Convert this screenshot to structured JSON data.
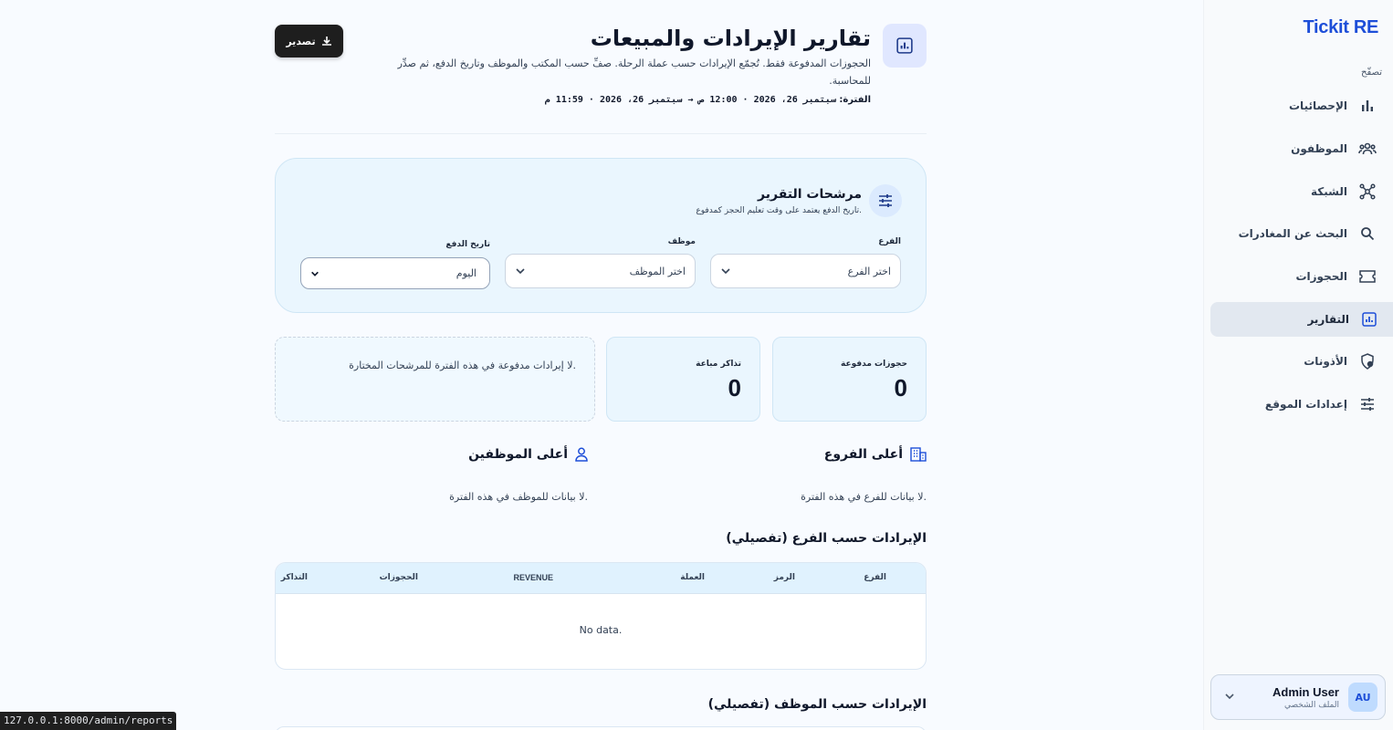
{
  "sidebar": {
    "brand": "Tickit RE",
    "nav_heading": "تصفّح",
    "items": [
      {
        "label": "الإحصائيات",
        "icon": "bar-chart-icon"
      },
      {
        "label": "الموظفون",
        "icon": "users-icon"
      },
      {
        "label": "الشبكة",
        "icon": "network-icon"
      },
      {
        "label": "البحث عن المغادرات",
        "icon": "search-icon"
      },
      {
        "label": "الحجوزات",
        "icon": "ticket-icon"
      },
      {
        "label": "التقارير",
        "icon": "report-icon",
        "active": true
      },
      {
        "label": "الأذونات",
        "icon": "shield-icon"
      },
      {
        "label": "إعدادات الموقع",
        "icon": "sliders-icon"
      }
    ],
    "user": {
      "initials": "AU",
      "name": "Admin User",
      "subtitle": "الملف الشخصي"
    }
  },
  "header": {
    "title": "تقارير الإيرادات والمبيعات",
    "description": "الحجوزات المدفوعة فقط. تُجمّع الإيرادات حسب عملة الرحلة. صفِّ حسب المكتب والموظف وتاريخ الدفع، ثم صدِّر للمحاسبة.",
    "period_label": "الفترة:",
    "period_value": "سبتمبر 26، 2026 · 12:00 ص → سبتمبر 26، 2026 · 11:59 م",
    "export_label": "تصدير"
  },
  "filters": {
    "title": "مرشحات التقرير",
    "subtitle": "تاريخ الدفع يعتمد على وقت تعليم الحجز كمدفوع.",
    "branch_label": "الفرع",
    "branch_value": "اختر الفرع",
    "employee_label": "موظف",
    "employee_value": "اختر الموظف",
    "date_label": "تاريخ الدفع",
    "date_value": "اليوم"
  },
  "stats": {
    "paid_bookings_label": "حجوزات مدفوعة",
    "paid_bookings_value": "0",
    "tickets_sold_label": "تذاكر مباعة",
    "tickets_sold_value": "0",
    "empty_revenue": "لا إيرادات مدفوعة في هذه الفترة للمرشحات المختارة."
  },
  "top_branches": {
    "title": "أعلى الفروع",
    "empty": "لا بيانات للفرع في هذه الفترة."
  },
  "top_employees": {
    "title": "أعلى الموظفين",
    "empty": "لا بيانات للموظف في هذه الفترة."
  },
  "branch_table": {
    "title": "الإيرادات حسب الفرع (تفصيلي)",
    "columns": [
      "الفرع",
      "الرمز",
      "العملة",
      "REVENUE",
      "الحجوزات",
      "التذاكر"
    ],
    "empty": "No data."
  },
  "employee_table": {
    "title": "الإيرادات حسب الموظف (تفصيلي)"
  },
  "status_url": "127.0.0.1:8000/admin/reports",
  "colors": {
    "accent": "#1d4ed8",
    "card_bg": "#eaf6fe",
    "dark_button": "#1e1e1e"
  }
}
